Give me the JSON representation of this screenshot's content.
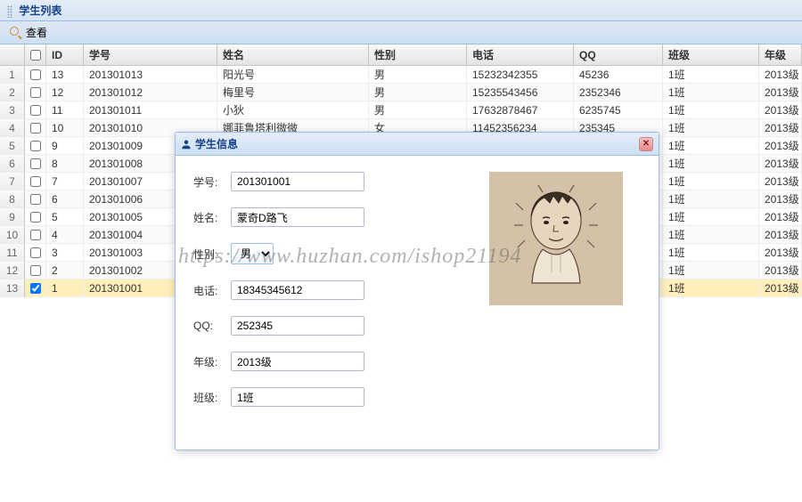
{
  "panel": {
    "title": "学生列表"
  },
  "toolbar": {
    "view_label": "查看"
  },
  "columns": {
    "id": "ID",
    "sno": "学号",
    "name": "姓名",
    "sex": "性别",
    "tel": "电话",
    "qq": "QQ",
    "class": "班级",
    "grade": "年级"
  },
  "rows": [
    {
      "n": "1",
      "chk": false,
      "id": "13",
      "sno": "201301013",
      "name": "阳光号",
      "sex": "男",
      "tel": "15232342355",
      "qq": "45236",
      "class": "1班",
      "grade": "2013级"
    },
    {
      "n": "2",
      "chk": false,
      "id": "12",
      "sno": "201301012",
      "name": "梅里号",
      "sex": "男",
      "tel": "15235543456",
      "qq": "2352346",
      "class": "1班",
      "grade": "2013级"
    },
    {
      "n": "3",
      "chk": false,
      "id": "11",
      "sno": "201301011",
      "name": "小狄",
      "sex": "男",
      "tel": "17632878467",
      "qq": "6235745",
      "class": "1班",
      "grade": "2013级"
    },
    {
      "n": "4",
      "chk": false,
      "id": "10",
      "sno": "201301010",
      "name": "娜菲鲁塔利微微",
      "sex": "女",
      "tel": "11452356234",
      "qq": "235345",
      "class": "1班",
      "grade": "2013级"
    },
    {
      "n": "5",
      "chk": false,
      "id": "9",
      "sno": "201301009",
      "name": "",
      "sex": "",
      "tel": "",
      "qq": "",
      "class": "1班",
      "grade": "2013级"
    },
    {
      "n": "6",
      "chk": false,
      "id": "8",
      "sno": "201301008",
      "name": "",
      "sex": "",
      "tel": "",
      "qq": "",
      "class": "1班",
      "grade": "2013级"
    },
    {
      "n": "7",
      "chk": false,
      "id": "7",
      "sno": "201301007",
      "name": "",
      "sex": "",
      "tel": "",
      "qq": "",
      "class": "1班",
      "grade": "2013级"
    },
    {
      "n": "8",
      "chk": false,
      "id": "6",
      "sno": "201301006",
      "name": "",
      "sex": "",
      "tel": "",
      "qq": "",
      "class": "1班",
      "grade": "2013级"
    },
    {
      "n": "9",
      "chk": false,
      "id": "5",
      "sno": "201301005",
      "name": "",
      "sex": "",
      "tel": "",
      "qq": "",
      "class": "1班",
      "grade": "2013级"
    },
    {
      "n": "10",
      "chk": false,
      "id": "4",
      "sno": "201301004",
      "name": "",
      "sex": "",
      "tel": "",
      "qq": "",
      "class": "1班",
      "grade": "2013级"
    },
    {
      "n": "11",
      "chk": false,
      "id": "3",
      "sno": "201301003",
      "name": "",
      "sex": "",
      "tel": "",
      "qq": "",
      "class": "1班",
      "grade": "2013级"
    },
    {
      "n": "12",
      "chk": false,
      "id": "2",
      "sno": "201301002",
      "name": "",
      "sex": "",
      "tel": "",
      "qq": "",
      "class": "1班",
      "grade": "2013级"
    },
    {
      "n": "13",
      "chk": true,
      "id": "1",
      "sno": "201301001",
      "name": "",
      "sex": "",
      "tel": "",
      "qq": "",
      "class": "1班",
      "grade": "2013级",
      "selected": true
    }
  ],
  "dialog": {
    "title": "学生信息",
    "labels": {
      "sno": "学号:",
      "name": "姓名:",
      "sex": "性别:",
      "tel": "电话:",
      "qq": "QQ:",
      "grade": "年级:",
      "class": "班级:"
    },
    "values": {
      "sno": "201301001",
      "name": "蒙奇D路飞",
      "sex": "男",
      "tel": "18345345612",
      "qq": "252345",
      "grade": "2013级",
      "class": "1班"
    }
  },
  "watermark": "https://www.huzhan.com/ishop21194"
}
